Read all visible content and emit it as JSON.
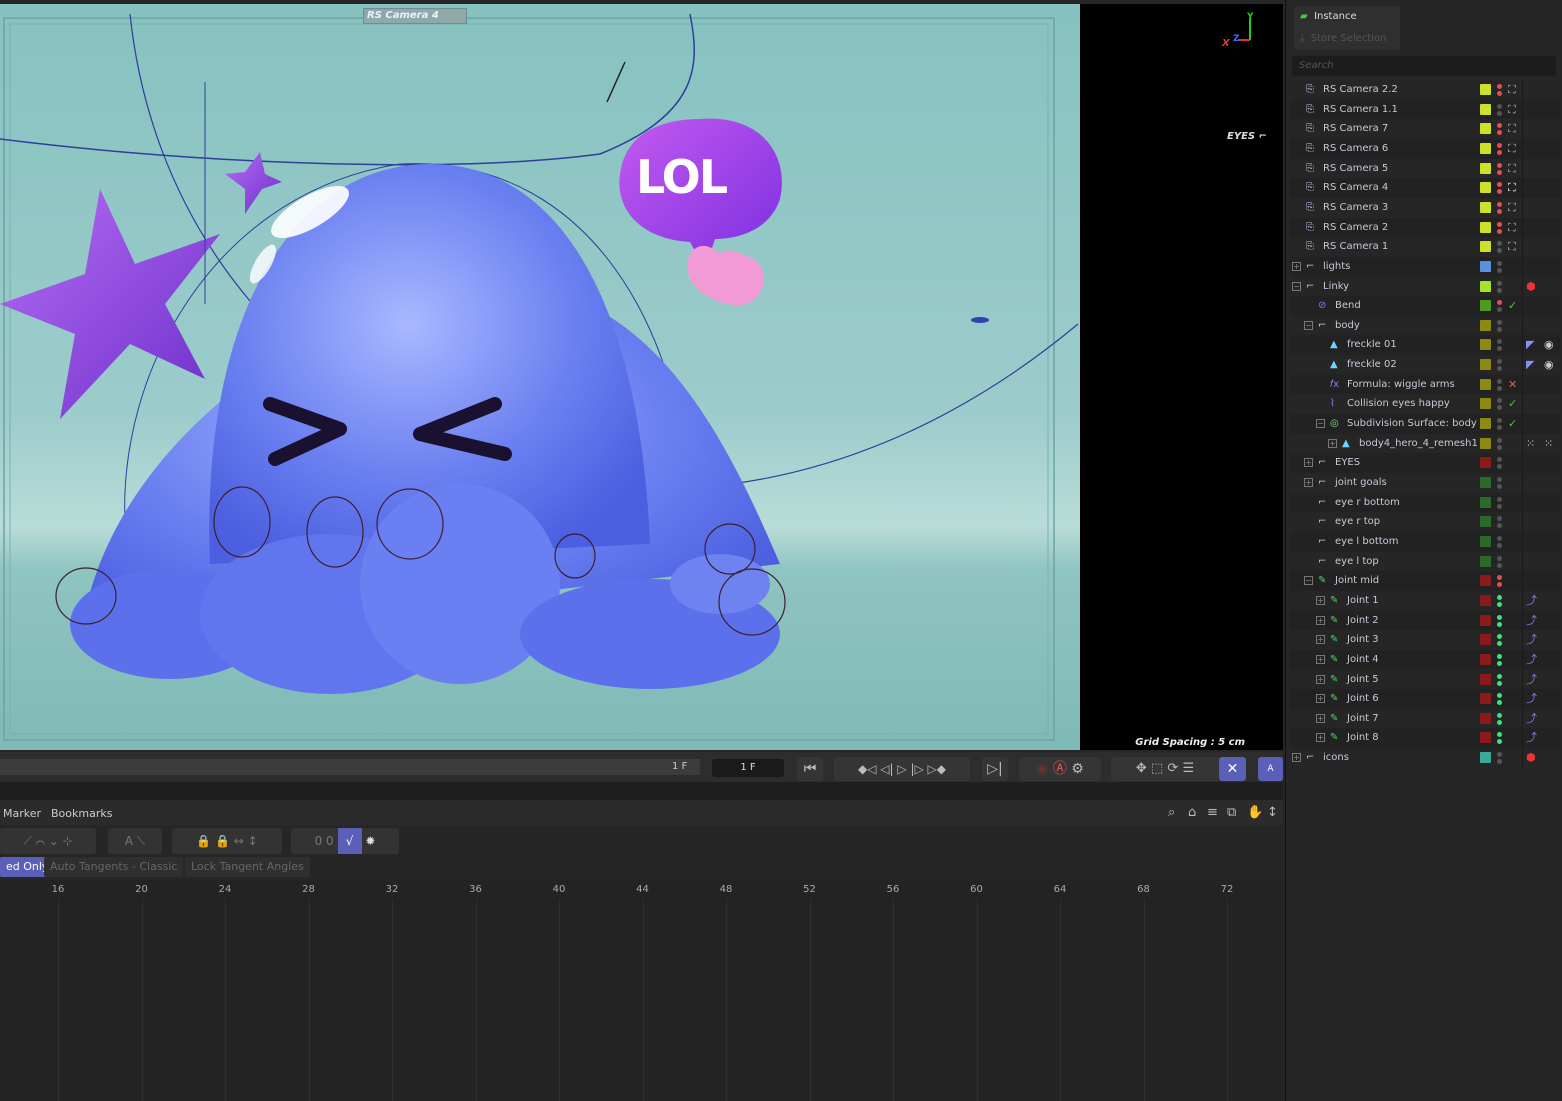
{
  "viewport": {
    "camera_label": "RS Camera 4",
    "bubble_text": "LOL",
    "eyes_label": "EYES",
    "grid_spacing": "Grid Spacing : 5 cm",
    "axis": {
      "x": "X",
      "y": "Y",
      "z": "Z"
    }
  },
  "timeline": {
    "frame_end": "1 F",
    "current_frame": "1 F",
    "buttons": [
      "go-to-start",
      "prev-key",
      "prev-frame",
      "play",
      "next-frame",
      "next-key",
      "go-to-end",
      "record",
      "autokey",
      "keyframe-settings",
      "key-pos",
      "key-scale",
      "key-rot",
      "key-param",
      "key-pla",
      "anim-layer"
    ],
    "active_color": "#5a5fb8"
  },
  "fcurve": {
    "menu": [
      "Marker",
      "Bookmarks"
    ],
    "options": [
      "ed Only",
      "Auto Tangents - Classic",
      "Lock Tangent Angles"
    ],
    "ruler": [
      "16",
      "20",
      "24",
      "28",
      "32",
      "36",
      "40",
      "44",
      "48",
      "52",
      "56",
      "60",
      "64",
      "68",
      "72"
    ]
  },
  "outliner": {
    "instance_label": "Instance",
    "store_selection_label": "Store Selection",
    "search_placeholder": "Search",
    "rows": [
      {
        "label": "RS Camera 2.2",
        "lvl": 0,
        "icon": "camera",
        "color": "#cde12c",
        "dots": [
          "#e05252",
          "#e05252"
        ],
        "tag": "camera-tag"
      },
      {
        "label": "RS Camera 1.1",
        "lvl": 0,
        "icon": "camera",
        "color": "#cde12c",
        "dots": [
          "#555",
          "#555"
        ],
        "tag": "camera-tag"
      },
      {
        "label": "RS Camera 7",
        "lvl": 0,
        "icon": "camera",
        "color": "#cde12c",
        "dots": [
          "#e05252",
          "#e05252"
        ],
        "tag": "camera-tag"
      },
      {
        "label": "RS Camera 6",
        "lvl": 0,
        "icon": "camera",
        "color": "#cde12c",
        "dots": [
          "#e05252",
          "#e05252"
        ],
        "tag": "camera-tag"
      },
      {
        "label": "RS Camera 5",
        "lvl": 0,
        "icon": "camera",
        "color": "#cde12c",
        "dots": [
          "#e05252",
          "#e05252"
        ],
        "tag": "camera-tag"
      },
      {
        "label": "RS Camera 4",
        "lvl": 0,
        "icon": "camera",
        "color": "#cde12c",
        "dots": [
          "#e05252",
          "#e05252"
        ],
        "tag": "camera-tag-active"
      },
      {
        "label": "RS Camera 3",
        "lvl": 0,
        "icon": "camera",
        "color": "#cde12c",
        "dots": [
          "#e05252",
          "#e05252"
        ],
        "tag": "camera-tag"
      },
      {
        "label": "RS Camera 2",
        "lvl": 0,
        "icon": "camera",
        "color": "#cde12c",
        "dots": [
          "#e05252",
          "#e05252"
        ],
        "tag": "camera-tag"
      },
      {
        "label": "RS Camera 1",
        "lvl": 0,
        "icon": "camera",
        "color": "#cde12c",
        "dots": [
          "#555",
          "#555"
        ],
        "tag": "camera-tag"
      },
      {
        "label": "lights",
        "lvl": 0,
        "icon": "null",
        "exp": "+",
        "color": "#5b8fe0",
        "dots": [
          "#555",
          "#555"
        ]
      },
      {
        "label": "Linky",
        "lvl": 0,
        "icon": "null",
        "exp": "-",
        "color": "#a6e22e",
        "dots": [
          "#555",
          "#555"
        ],
        "tag": "redshift-object-tag"
      },
      {
        "label": "Bend",
        "lvl": 1,
        "icon": "bend",
        "color": "#4c9a1e",
        "dots": [
          "#e05252",
          "#555"
        ],
        "tag": "check"
      },
      {
        "label": "body",
        "lvl": 1,
        "icon": "null",
        "exp": "-",
        "color": "#8d8a14",
        "dots": [
          "#555",
          "#555"
        ]
      },
      {
        "label": "freckle 01",
        "lvl": 2,
        "icon": "polygon",
        "color": "#8d8a14",
        "dots": [
          "#555",
          "#555"
        ],
        "tag": "selection-tag",
        "tag2": "material-tag"
      },
      {
        "label": "freckle 02",
        "lvl": 2,
        "icon": "polygon",
        "color": "#8d8a14",
        "dots": [
          "#555",
          "#555"
        ],
        "tag": "selection-tag",
        "tag2": "material-tag"
      },
      {
        "label": "Formula: wiggle arms",
        "lvl": 2,
        "icon": "formula",
        "color": "#8d8a14",
        "dots": [
          "#555",
          "#555"
        ],
        "tag": "cross"
      },
      {
        "label": "Collision eyes happy",
        "lvl": 2,
        "icon": "collision",
        "color": "#8d8a14",
        "dots": [
          "#555",
          "#555"
        ],
        "tag": "check"
      },
      {
        "label": "Subdivision Surface: body",
        "lvl": 2,
        "icon": "subdivision",
        "exp": "-",
        "color": "#8d8a14",
        "dots": [
          "#555",
          "#555"
        ],
        "tag": "check"
      },
      {
        "label": "body4_hero_4_remesh1",
        "lvl": 3,
        "icon": "polygon",
        "exp": "+",
        "color": "#8d8a14",
        "dots": [
          "#555",
          "#555"
        ],
        "tag": "point-selection-tag",
        "tag2": "point-selection-tag"
      },
      {
        "label": "EYES",
        "lvl": 1,
        "icon": "null",
        "exp": "+",
        "color": "#8b1a1a",
        "dots": [
          "#555",
          "#555"
        ]
      },
      {
        "label": "joint goals",
        "lvl": 1,
        "icon": "null",
        "exp": "+",
        "color": "#2a6a2a",
        "dots": [
          "#555",
          "#555"
        ]
      },
      {
        "label": "eye  r bottom",
        "lvl": 1,
        "icon": "null",
        "color": "#2a6a2a",
        "dots": [
          "#555",
          "#555"
        ]
      },
      {
        "label": "eye r top",
        "lvl": 1,
        "icon": "null",
        "color": "#2a6a2a",
        "dots": [
          "#555",
          "#555"
        ]
      },
      {
        "label": "eye  l bottom",
        "lvl": 1,
        "icon": "null",
        "color": "#2a6a2a",
        "dots": [
          "#555",
          "#555"
        ]
      },
      {
        "label": "eye l top",
        "lvl": 1,
        "icon": "null",
        "color": "#2a6a2a",
        "dots": [
          "#555",
          "#555"
        ]
      },
      {
        "label": "Joint mid",
        "lvl": 1,
        "icon": "joint",
        "exp": "-",
        "color": "#8b1a1a",
        "dots": [
          "#e05252",
          "#e05252"
        ]
      },
      {
        "label": "Joint 1",
        "lvl": 2,
        "icon": "joint",
        "exp": "+",
        "color": "#8b1a1a",
        "dots": [
          "#3de27a",
          "#3de27a"
        ],
        "tag": "ik-tag"
      },
      {
        "label": "Joint 2",
        "lvl": 2,
        "icon": "joint",
        "exp": "+",
        "color": "#8b1a1a",
        "dots": [
          "#3de27a",
          "#3de27a"
        ],
        "tag": "ik-tag"
      },
      {
        "label": "Joint 3",
        "lvl": 2,
        "icon": "joint",
        "exp": "+",
        "color": "#8b1a1a",
        "dots": [
          "#3de27a",
          "#3de27a"
        ],
        "tag": "ik-tag"
      },
      {
        "label": "Joint 4",
        "lvl": 2,
        "icon": "joint",
        "exp": "+",
        "color": "#8b1a1a",
        "dots": [
          "#3de27a",
          "#3de27a"
        ],
        "tag": "ik-tag"
      },
      {
        "label": "Joint 5",
        "lvl": 2,
        "icon": "joint",
        "exp": "+",
        "color": "#8b1a1a",
        "dots": [
          "#3de27a",
          "#3de27a"
        ],
        "tag": "ik-tag"
      },
      {
        "label": "Joint 6",
        "lvl": 2,
        "icon": "joint",
        "exp": "+",
        "color": "#8b1a1a",
        "dots": [
          "#3de27a",
          "#3de27a"
        ],
        "tag": "ik-tag"
      },
      {
        "label": "Joint 7",
        "lvl": 2,
        "icon": "joint",
        "exp": "+",
        "color": "#8b1a1a",
        "dots": [
          "#3de27a",
          "#3de27a"
        ],
        "tag": "ik-tag"
      },
      {
        "label": "Joint 8",
        "lvl": 2,
        "icon": "joint",
        "exp": "+",
        "color": "#8b1a1a",
        "dots": [
          "#3de27a",
          "#3de27a"
        ],
        "tag": "ik-tag"
      },
      {
        "label": "icons",
        "lvl": 0,
        "icon": "null",
        "exp": "+",
        "color": "#3aaa9a",
        "dots": [
          "#555",
          "#555"
        ],
        "tag": "redshift-object-tag"
      }
    ]
  }
}
